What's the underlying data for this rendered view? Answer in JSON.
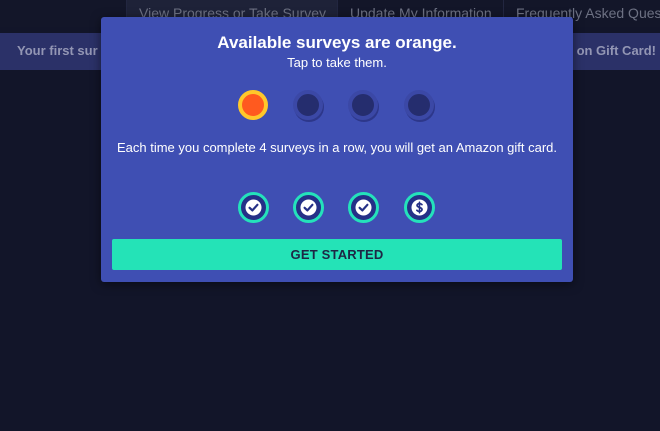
{
  "nav": {
    "items": [
      {
        "label": "View Progress or Take Survey"
      },
      {
        "label": "Update My Information"
      },
      {
        "label": "Frequently Asked Ques"
      }
    ]
  },
  "banner": {
    "left_text": "Your first sur",
    "right_text": "on Gift Card!"
  },
  "modal": {
    "title": "Available surveys are orange.",
    "subtitle": "Tap to take them.",
    "survey_dots": [
      "available",
      "unavailable",
      "unavailable",
      "unavailable"
    ],
    "description": "Each time you complete 4 surveys in a row, you will get an Amazon gift card.",
    "progress_icons": [
      "check-icon",
      "check-icon",
      "check-icon",
      "dollar-icon"
    ],
    "button_label": "GET STARTED",
    "colors": {
      "modal_bg": "#3f4fb3",
      "available_fill": "#ff5a1f",
      "available_ring": "#ffc82a",
      "accent": "#24e3b7"
    }
  }
}
